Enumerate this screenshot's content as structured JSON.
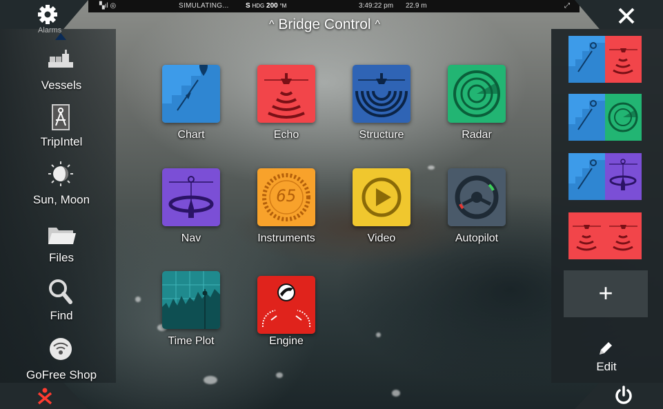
{
  "status_bar": {
    "simulating": "SIMULATING...",
    "heading_prefix": "S",
    "heading_label": "HDG",
    "heading_value": "200",
    "heading_unit": "°M",
    "time": "3:49:22 pm",
    "depth": "22.9 m"
  },
  "title": {
    "text": "Bridge Control",
    "chevron_left": "^",
    "chevron_right": "^"
  },
  "left_sidebar": {
    "partial_label": "Alarms",
    "items": [
      {
        "label": "Vessels",
        "icon": "vessels-icon"
      },
      {
        "label": "TripIntel",
        "icon": "tripintel-icon"
      },
      {
        "label": "Sun, Moon",
        "icon": "sun-moon-icon"
      },
      {
        "label": "Files",
        "icon": "folder-icon"
      },
      {
        "label": "Find",
        "icon": "magnifier-icon"
      },
      {
        "label": "GoFree Shop",
        "icon": "gofree-icon"
      }
    ]
  },
  "apps": [
    {
      "label": "Chart",
      "color": "#3d9be9"
    },
    {
      "label": "Echo",
      "color": "#f2454a"
    },
    {
      "label": "Structure",
      "color": "#2f64b5"
    },
    {
      "label": "Radar",
      "color": "#22b573"
    },
    {
      "label": "Nav",
      "color": "#7b4fd6"
    },
    {
      "label": "Instruments",
      "color": "#f8a22b",
      "gauge_value": "65"
    },
    {
      "label": "Video",
      "color": "#f0c72e"
    },
    {
      "label": "Autopilot",
      "color": "#4a5a6a"
    },
    {
      "label": "Time Plot",
      "color": "#1f8a8e"
    },
    {
      "label": "Engine",
      "color": "#e0231c"
    }
  ],
  "right_sidebar": {
    "favorites": [
      {
        "name": "chart-echo",
        "left": "#3d9be9",
        "right": "#f2454a"
      },
      {
        "name": "chart-radar",
        "left": "#3d9be9",
        "right": "#22b573"
      },
      {
        "name": "chart-nav",
        "left": "#3d9be9",
        "right": "#7b4fd6"
      },
      {
        "name": "echo-echo",
        "left": "#f2454a",
        "right": "#f2454a"
      }
    ],
    "add_label": "+",
    "edit_label": "Edit"
  },
  "accent": {
    "alarm": "#ff3b30"
  }
}
